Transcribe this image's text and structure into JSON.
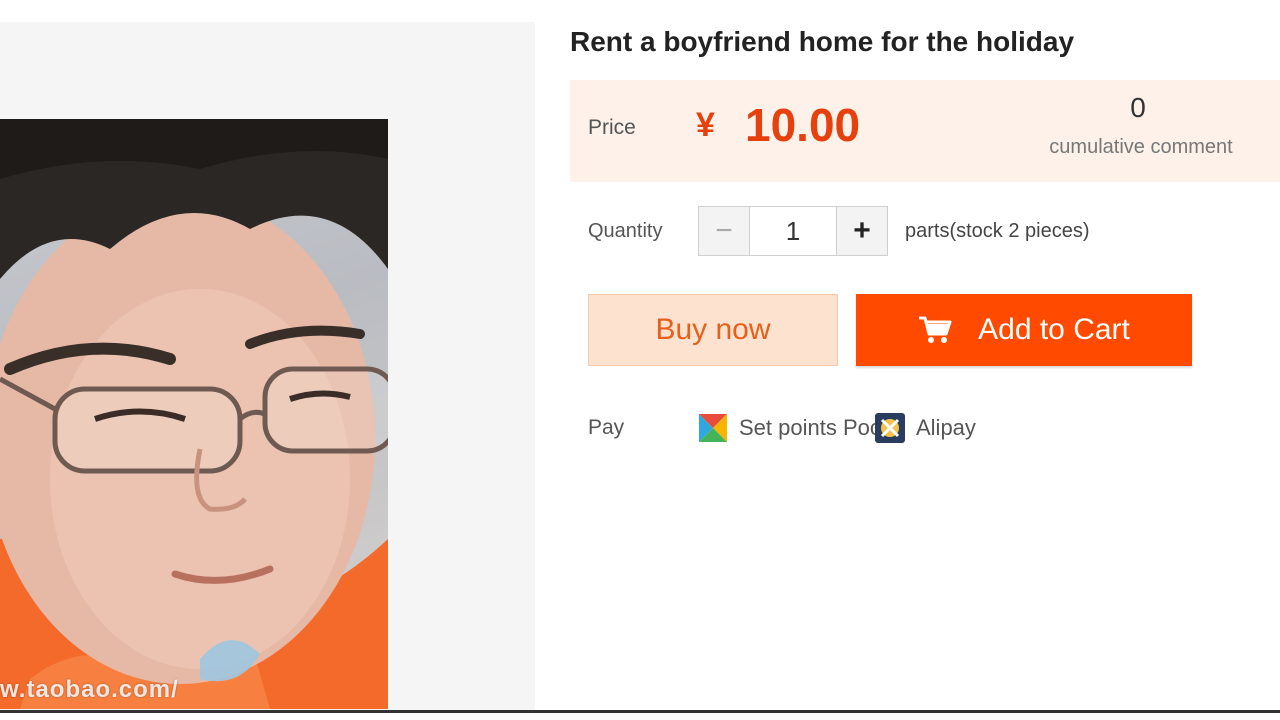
{
  "product": {
    "title": "Rent a boyfriend home for the holiday",
    "image_watermark": "w.taobao.com/"
  },
  "price_panel": {
    "price_label": "Price",
    "currency_symbol": "¥",
    "price_value": "10.00",
    "comments_count": "0",
    "comments_label": "cumulative comment"
  },
  "quantity": {
    "label": "Quantity",
    "minus_symbol": "−",
    "value": "1",
    "plus_symbol": "+",
    "stock_text": "parts(stock 2 pieces)"
  },
  "actions": {
    "buy_now_label": "Buy now",
    "add_to_cart_label": "Add to Cart"
  },
  "payment": {
    "label": "Pay",
    "options": [
      {
        "label": "Set points Pocket",
        "icon": "points-icon"
      },
      {
        "label": "Alipay",
        "icon": "alipay-icon"
      }
    ]
  },
  "colors": {
    "accent": "#ff4a00",
    "price": "#e6400c",
    "price_panel_bg": "#fdf1ea",
    "buy_now_bg": "#fde3cf"
  }
}
